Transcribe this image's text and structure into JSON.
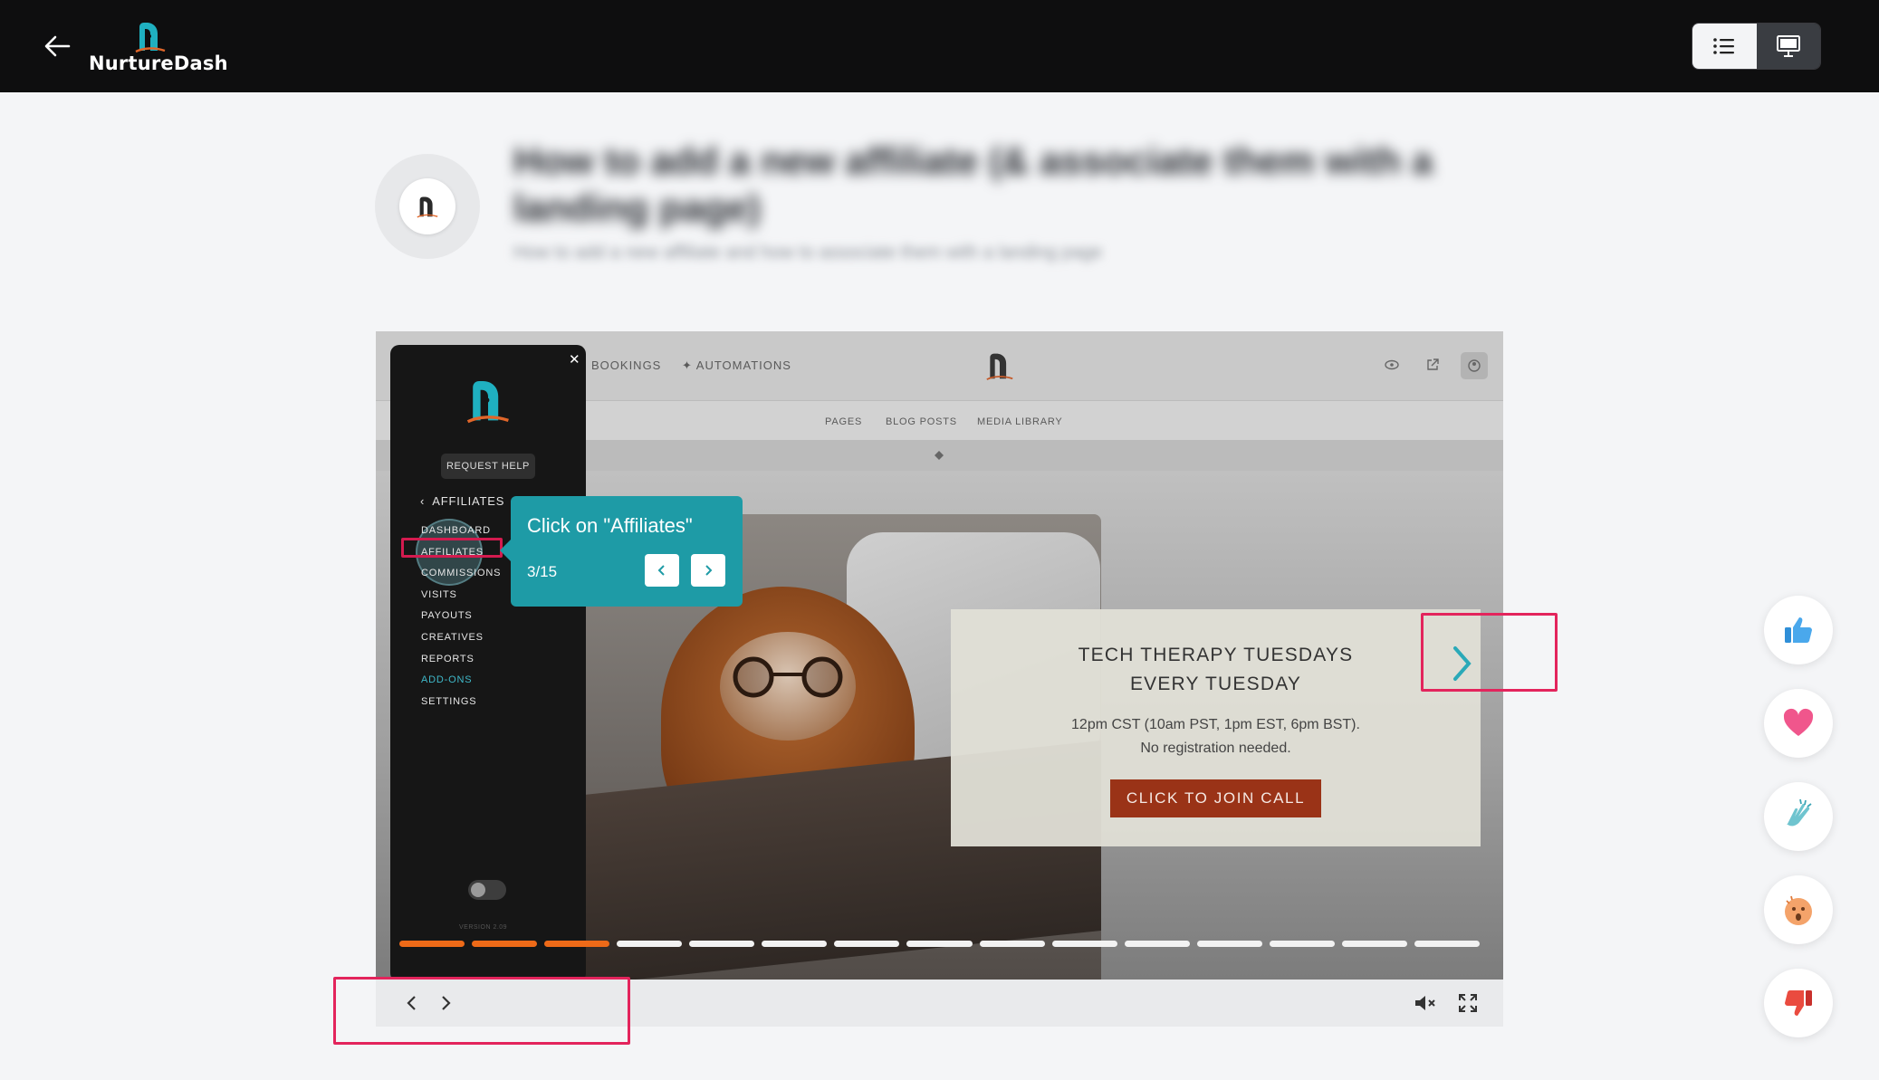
{
  "header": {
    "brand_name": "NurtureDash",
    "icons": [
      "back-arrow-icon",
      "list-view-icon",
      "slides-view-icon"
    ]
  },
  "guide": {
    "title": "How to add a new affiliate (& associate them with a landing page)",
    "subtitle": "How to add a new affiliate and how to associate them with a landing page"
  },
  "screenshot": {
    "top_nav": [
      "BOOKINGS",
      "AUTOMATIONS"
    ],
    "sub_nav": [
      "PAGES",
      "BLOG POSTS",
      "MEDIA LIBRARY"
    ],
    "panel": {
      "help_label": "REQUEST HELP",
      "back_label": "AFFILIATES",
      "menu": [
        "DASHBOARD",
        "AFFILIATES",
        "COMMISSIONS",
        "VISITS",
        "PAYOUTS",
        "CREATIVES",
        "REPORTS",
        "ADD-ONS",
        "SETTINGS"
      ],
      "version": "VERSION 2.09"
    },
    "event": {
      "title_line1": "TECH THERAPY TUESDAYS",
      "title_line2": "EVERY TUESDAY",
      "time_line": "12pm CST (10am PST, 1pm EST, 6pm BST).",
      "note_line": "No registration needed.",
      "button_label": "CLICK TO JOIN CALL"
    }
  },
  "tooltip": {
    "text": "Click on \"Affiliates\"",
    "counter": "3/15"
  },
  "progress": {
    "total_steps": 15,
    "completed_steps": 3,
    "colors": {
      "done": "#ee6a18",
      "todo": "#f2f2f2"
    }
  },
  "reactions": [
    "thumbs-up-icon",
    "heart-icon",
    "clapping-hands-icon",
    "surprised-face-icon",
    "thumbs-down-icon"
  ],
  "colors": {
    "accent_teal": "#1e9ba6",
    "annotation_pink": "#e3245c",
    "join_button": "#9a3317"
  }
}
